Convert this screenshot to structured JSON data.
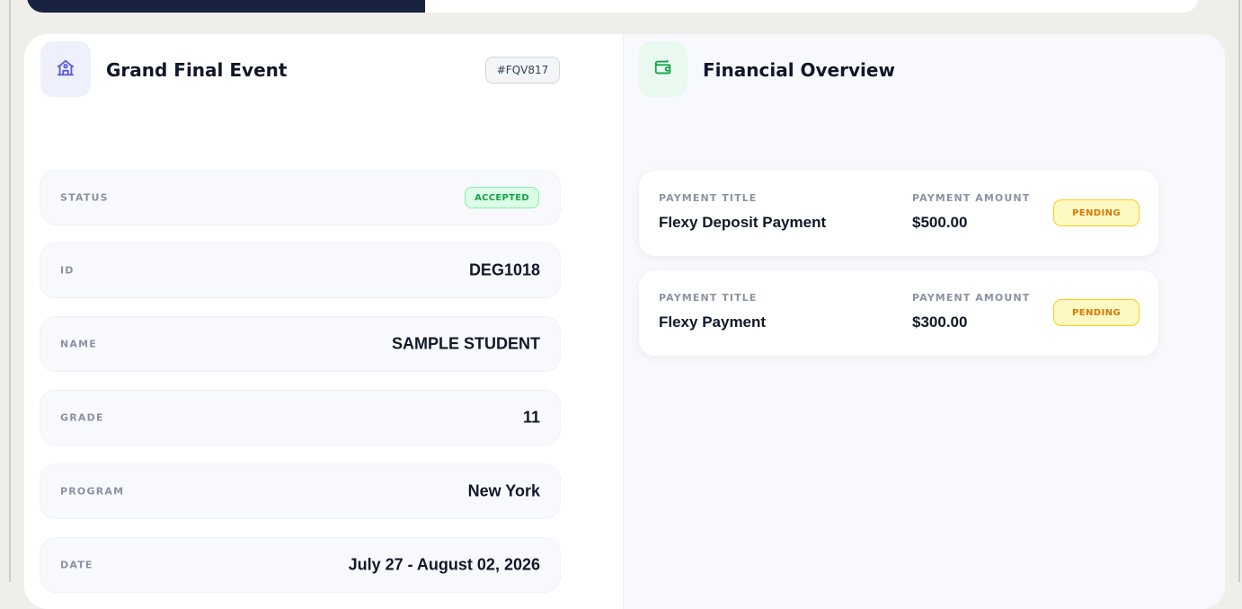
{
  "event": {
    "title": "Grand Final Event",
    "code": "#FQV817",
    "icon": "building-icon",
    "accent": "#5b5bd6"
  },
  "details": [
    {
      "key": "status",
      "label": "STATUS",
      "value": "ACCEPTED",
      "is_badge": true
    },
    {
      "key": "id",
      "label": "ID",
      "value": "DEG1018"
    },
    {
      "key": "name",
      "label": "NAME",
      "value": "SAMPLE STUDENT"
    },
    {
      "key": "grade",
      "label": "GRADE",
      "value": "11"
    },
    {
      "key": "program",
      "label": "PROGRAM",
      "value": "New York"
    },
    {
      "key": "date",
      "label": "DATE",
      "value": "July 27 - August 02, 2026"
    }
  ],
  "financial": {
    "title": "Financial Overview",
    "icon": "wallet-icon",
    "accent": "#16a34a",
    "payments": [
      {
        "title_label": "PAYMENT TITLE",
        "title": "Flexy Deposit Payment",
        "amount_label": "PAYMENT AMOUNT",
        "amount": "$500.00",
        "status": "PENDING"
      },
      {
        "title_label": "PAYMENT TITLE",
        "title": "Flexy Payment",
        "amount_label": "PAYMENT AMOUNT",
        "amount": "$300.00",
        "status": "PENDING"
      }
    ]
  },
  "colors": {
    "status_accepted": "#16a34a",
    "status_pending": "#d97706",
    "top_bar": "#17233f"
  }
}
